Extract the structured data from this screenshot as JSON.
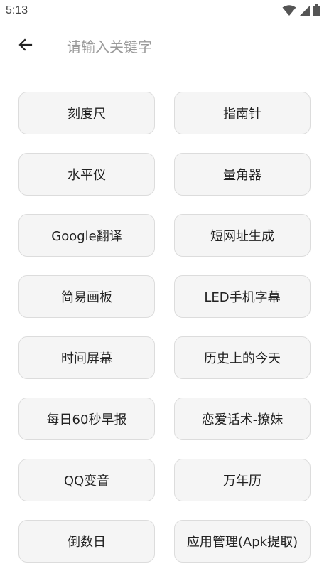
{
  "status_bar": {
    "time": "5:13",
    "icons": [
      "wifi-icon",
      "signal-icon",
      "battery-icon"
    ]
  },
  "search": {
    "placeholder": "请输入关键字",
    "value": "",
    "back_icon": "arrow-left-icon"
  },
  "tools": [
    {
      "label": "刻度尺"
    },
    {
      "label": "指南针"
    },
    {
      "label": "水平仪"
    },
    {
      "label": "量角器"
    },
    {
      "label": "Google翻译"
    },
    {
      "label": "短网址生成"
    },
    {
      "label": "简易画板"
    },
    {
      "label": "LED手机字幕"
    },
    {
      "label": "时间屏幕"
    },
    {
      "label": "历史上的今天"
    },
    {
      "label": "每日60秒早报"
    },
    {
      "label": "恋爱话术-撩妹"
    },
    {
      "label": "QQ变音"
    },
    {
      "label": "万年历"
    },
    {
      "label": "倒数日"
    },
    {
      "label": "应用管理(Apk提取)"
    }
  ]
}
